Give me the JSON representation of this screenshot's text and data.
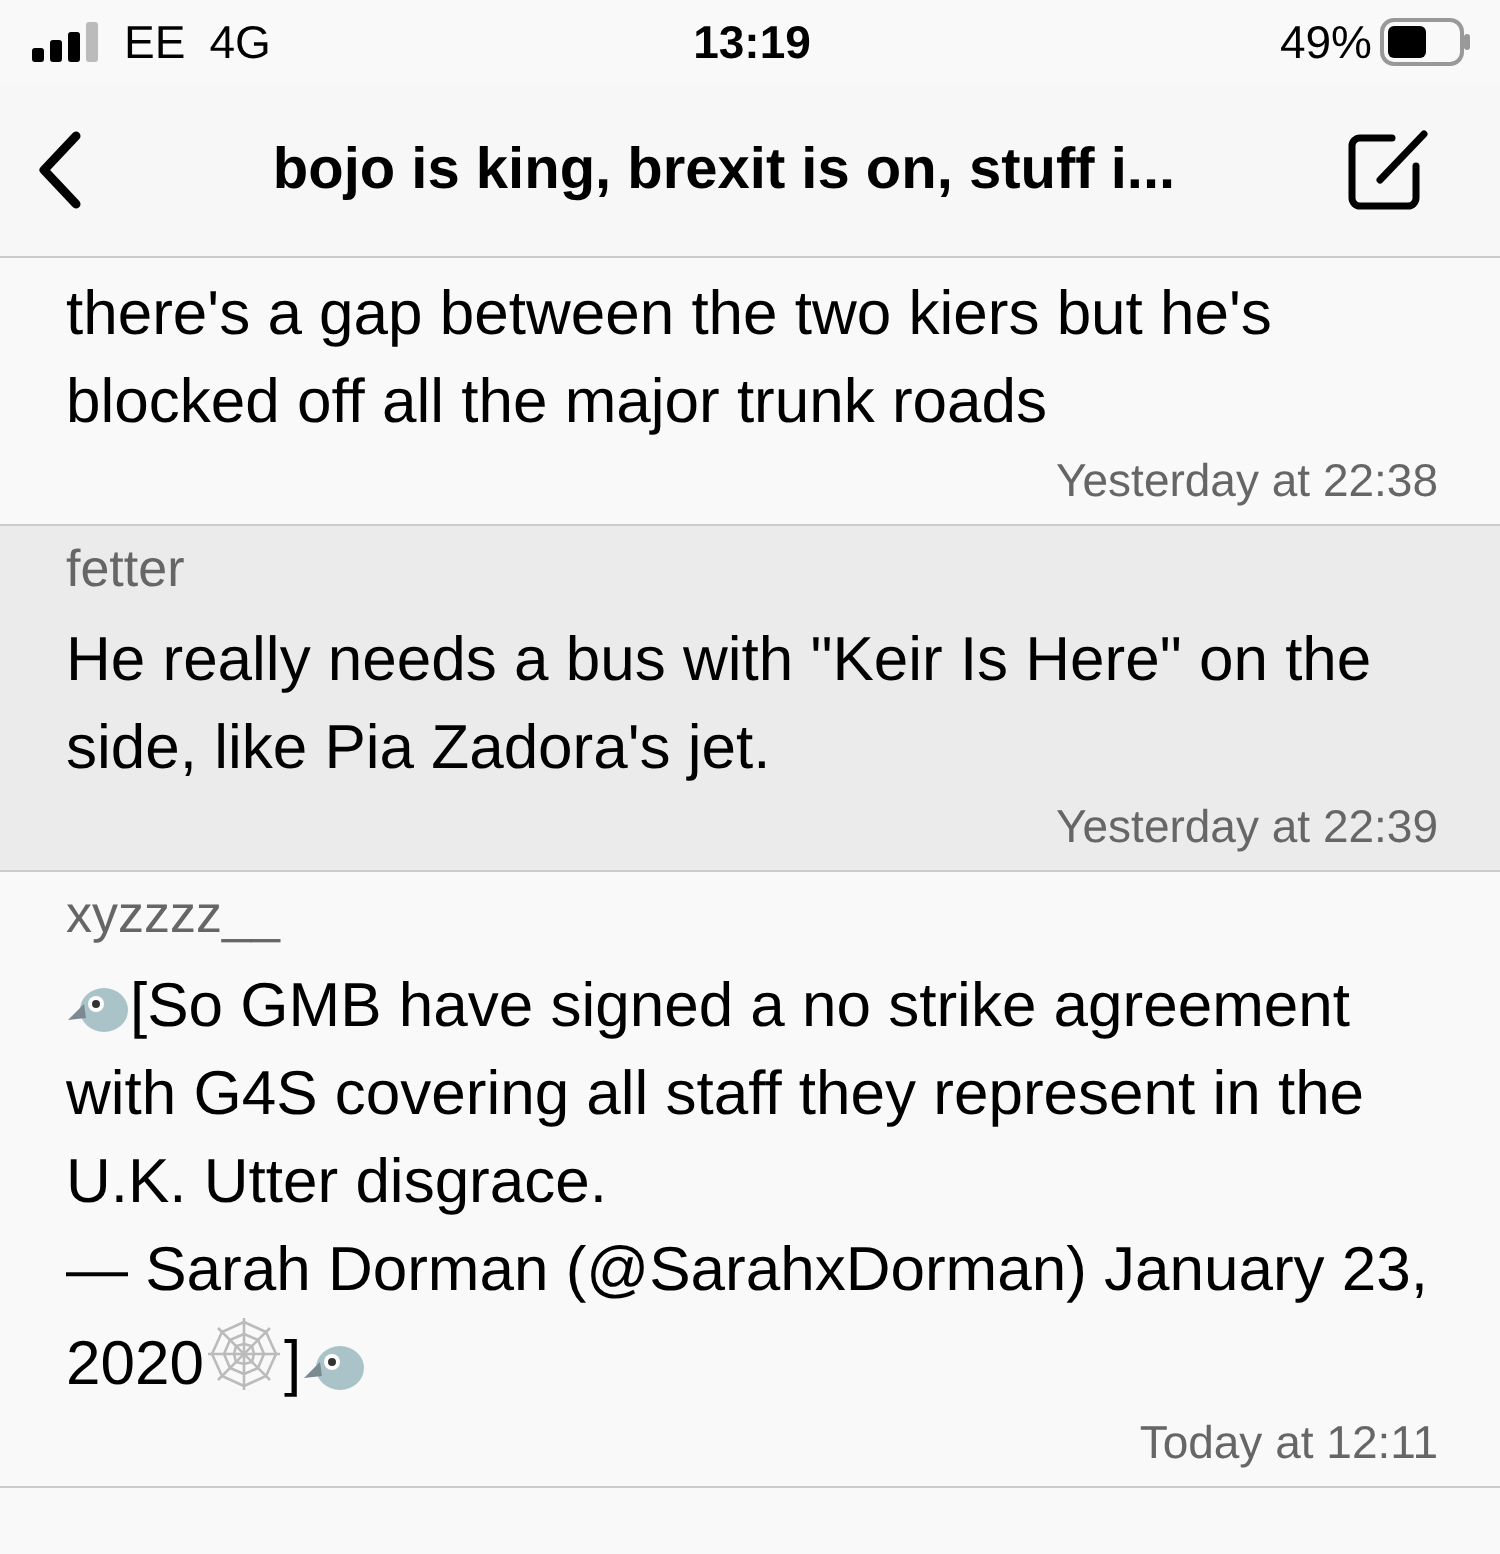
{
  "status_bar": {
    "carrier": "EE",
    "network": "4G",
    "time": "13:19",
    "battery": "49%"
  },
  "nav": {
    "title": "bojo is king, brexit is on, stuff i..."
  },
  "messages": [
    {
      "highlighted": false,
      "body": [
        {
          "kind": "text",
          "text": "there's a gap between the two kiers but he's blocked off all the major trunk roads"
        }
      ],
      "time": "Yesterday at 22:38"
    },
    {
      "author": "fetter",
      "highlighted": true,
      "body": [
        {
          "kind": "text",
          "text": "He really needs a bus with \"Keir Is Here\" on the side, like Pia Zadora's jet."
        }
      ],
      "time": "Yesterday at 22:39"
    },
    {
      "author": "xyzzzz__",
      "highlighted": false,
      "body": [
        {
          "kind": "bird"
        },
        {
          "kind": "text",
          "text": "[So GMB have signed a no strike agreement with G4S covering all staff they represent in the U.K. Utter disgrace.\n— Sarah Dorman (@SarahxDorman) January 23, 2020"
        },
        {
          "kind": "web"
        },
        {
          "kind": "text",
          "text": "]"
        },
        {
          "kind": "bird"
        }
      ],
      "time": "Today at 12:11"
    }
  ]
}
